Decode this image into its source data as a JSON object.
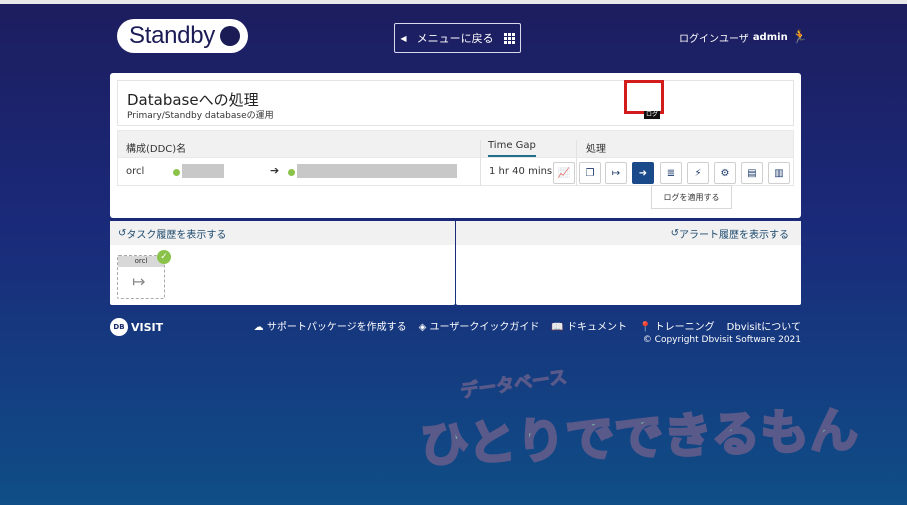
{
  "header": {
    "logo_text": "Standby",
    "menu_button": "メニューに戻る",
    "login_label": "ログインユーザ",
    "login_user": "admin"
  },
  "panel": {
    "title": "Databaseへの処理",
    "subtitle": "Primary/Standby databaseの運用",
    "columns": {
      "config": "構成(DDC)名",
      "timegap": "Time Gap",
      "process": "処理"
    },
    "row": {
      "name": "orcl",
      "timegap": "1 hr 40 mins"
    },
    "actions": [
      "copy-icon",
      "sign-out-icon",
      "sign-in-icon",
      "database-icon",
      "bolt-icon",
      "cogs-icon",
      "file-icon",
      "file-text-icon"
    ],
    "mini_label": "ログ",
    "tooltip": "ログを適用する"
  },
  "lower": {
    "task_history": "タスク履歴を表示する",
    "alert_history": "アラート履歴を表示する",
    "task_tag": "orcl"
  },
  "footer": {
    "brand": "VISIT",
    "brand_circle": "DB",
    "links": {
      "support": "サポートパッケージを作成する",
      "guide": "ユーザークイックガイド",
      "docs": "ドキュメント",
      "tracing": "トレーニング",
      "about": "Dbvisitについて"
    },
    "copyright": "© Copyright Dbvisit Software 2021"
  },
  "watermark": {
    "sub": "データベース",
    "main": "ひとりでできるもん"
  },
  "colors": {
    "accent": "#1e6f8a",
    "highlight": "#d21b1b",
    "status_ok": "#8bc34a"
  }
}
